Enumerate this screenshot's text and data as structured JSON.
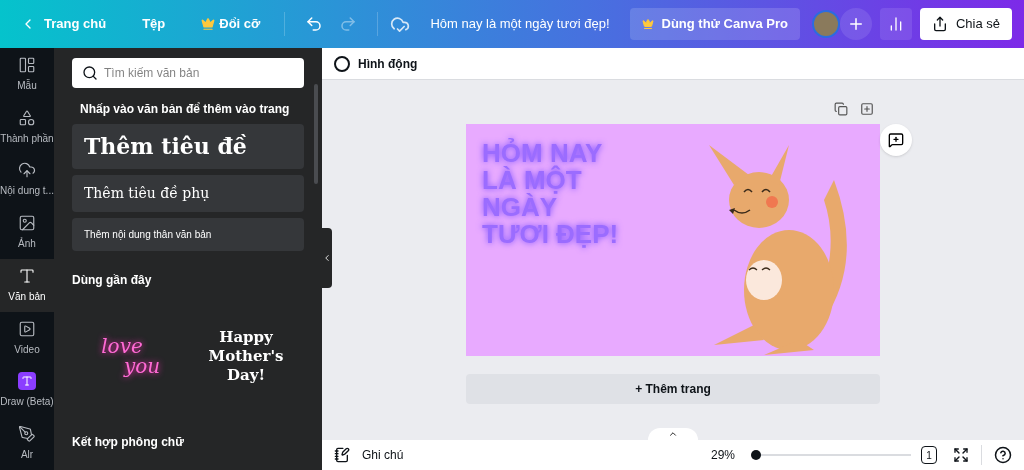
{
  "top_bar": {
    "back": "Trang chủ",
    "file": "Tệp",
    "resize": "Đổi cỡ",
    "design_title": "Hôm nay là một ngày tươi đẹp!",
    "pro": "Dùng thử Canva Pro",
    "share": "Chia sẻ"
  },
  "sidebar": {
    "items": [
      {
        "label": "Mẫu",
        "selected": false
      },
      {
        "label": "Thành phần",
        "selected": false
      },
      {
        "label": "Nội dung t...",
        "selected": false
      },
      {
        "label": "Ảnh",
        "selected": false
      },
      {
        "label": "Văn bản",
        "selected": true
      },
      {
        "label": "Video",
        "selected": false
      },
      {
        "label": "Draw (Beta)",
        "selected": false
      },
      {
        "label": "Alr",
        "selected": false
      }
    ]
  },
  "panel": {
    "search": {
      "placeholder": "Tìm kiếm văn bản"
    },
    "hint": "Nhấp vào văn bản để thêm vào trang",
    "text_buttons": [
      {
        "label": "Thêm tiêu đề",
        "kind": "heading"
      },
      {
        "label": "Thêm tiêu đề phụ",
        "kind": "subheading"
      },
      {
        "label": "Thêm nội dung thân văn bản",
        "kind": "body"
      }
    ],
    "recent_heading": "Dùng gần đây",
    "recent": [
      {
        "kind": "neon",
        "lines": [
          "love",
          "you"
        ]
      },
      {
        "kind": "card",
        "lines": [
          "Happy",
          "Mother's",
          "Day!"
        ]
      }
    ],
    "font_combos_heading": "Kết hợp phông chữ"
  },
  "toolbar": {
    "animate": "Hình động"
  },
  "page": {
    "lines": [
      "HỎM NAY",
      "LÀ MỘT",
      "NGÀY",
      "TƯƠI ĐẸP!"
    ]
  },
  "add_page": "+ Thêm trang",
  "footer": {
    "notes": "Ghi chú",
    "zoom": "29%",
    "zoom_slider": {
      "level": 0
    },
    "page_count": "1"
  }
}
